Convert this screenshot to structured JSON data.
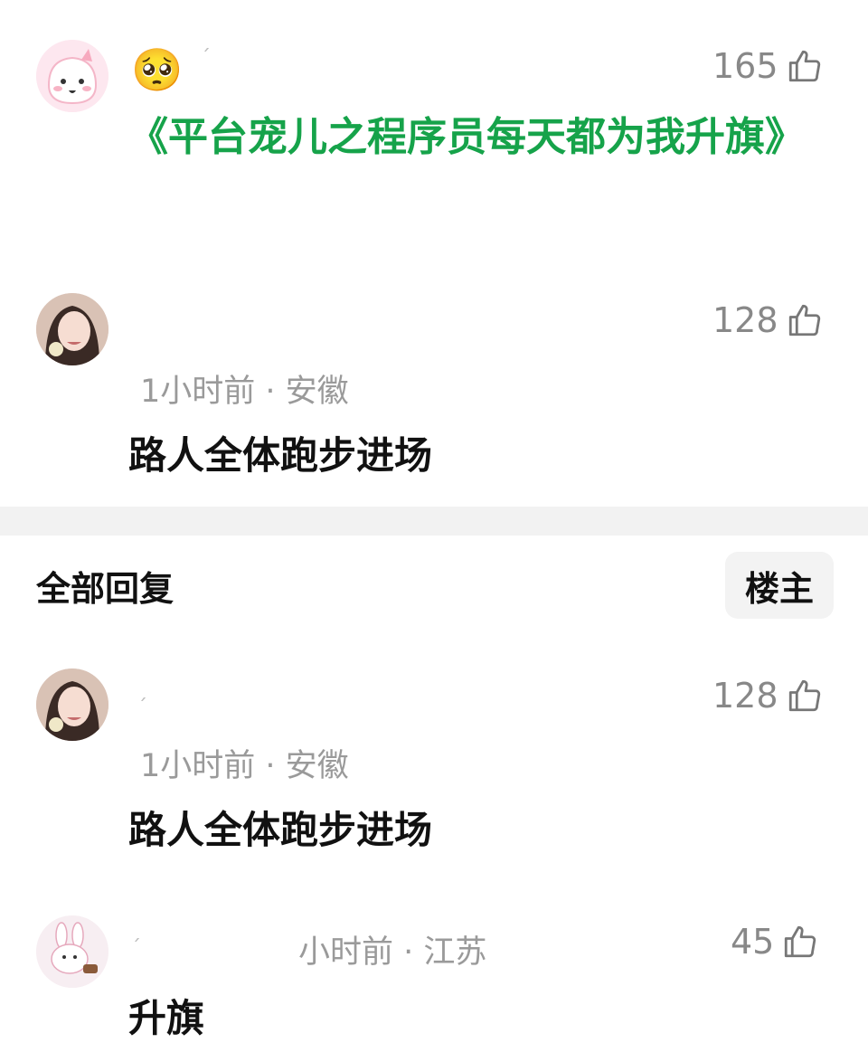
{
  "comment_main": {
    "emoji": "🥺",
    "likes": "165",
    "text": "《平台宠儿之程序员每天都为我升旗》"
  },
  "comment_1": {
    "likes": "128",
    "meta": "1小时前 · 安徽",
    "text": "路人全体跑步进场"
  },
  "replies_section": {
    "title": "全部回复",
    "owner_button": "楼主"
  },
  "reply_1": {
    "likes": "128",
    "meta": "1小时前 · 安徽",
    "text": "路人全体跑步进场"
  },
  "reply_2": {
    "likes": "45",
    "meta": "小时前 · 江苏",
    "text": "升旗"
  },
  "colors": {
    "accent_green": "#16a34a",
    "muted_gray": "#9a9a9a",
    "divider_gray": "#f2f2f2"
  },
  "icons": [
    "thumbs-up-icon",
    "avatar-cartoon",
    "avatar-photo",
    "avatar-bunny"
  ]
}
